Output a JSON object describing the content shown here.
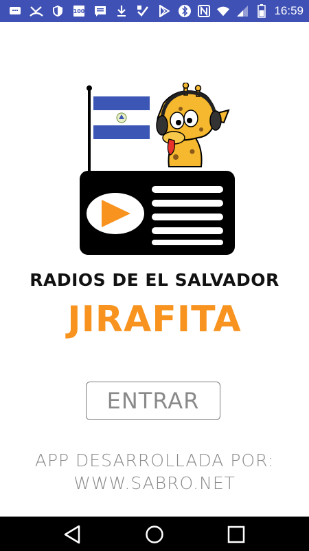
{
  "status_bar": {
    "time": "16:59",
    "left_icons": [
      "chat-icon",
      "missed-call-icon",
      "shield-icon",
      "news-icon",
      "message-icon",
      "download-icon",
      "checkbox-icon",
      "play-store-icon"
    ],
    "right_icons": [
      "bluetooth-icon",
      "nfc-icon",
      "wifi-icon",
      "signal-icon",
      "battery-icon"
    ],
    "bar_color": "#3f51b5"
  },
  "app": {
    "title": "RADIOS DE EL SALVADOR",
    "subtitle": "JIRAFITA",
    "subtitle_color": "#f7931e",
    "enter_button": "ENTRAR",
    "credits_line1": "APP DESARROLLADA POR:",
    "credits_line2": "WWW.SABRO.NET",
    "logo_icon": "radio-giraffe-logo",
    "flag": "el-salvador-flag"
  },
  "nav_bar": {
    "buttons": [
      "back-icon",
      "home-icon",
      "recent-apps-icon"
    ]
  }
}
